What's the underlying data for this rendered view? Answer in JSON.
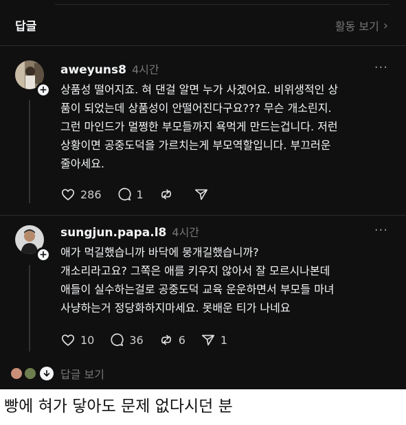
{
  "header": {
    "title": "답글",
    "activity_label": "활동 보기",
    "activity_chevron": "›"
  },
  "comments": [
    {
      "username": "aweyuns8",
      "time": "4시간",
      "more": "···",
      "lines": [
        "상품성 떨어지죠. 혀 댄걸 알면 누가 사겠어요. 비위생적인 상",
        "품이 되었는데 상품성이 안떨어진다구요??? 무슨 개소린지.",
        "그런 마인드가 멀쩡한 부모들까지 욕먹게 만드는겁니다. 저런",
        "상황이면 공중도덕을 가르치는게 부모역할입니다. 부끄러운",
        "줄아세요."
      ],
      "likes": "286",
      "replies": "1",
      "reposts": "",
      "shares": ""
    },
    {
      "username": "sungjun.papa.l8",
      "time": "4시간",
      "more": "···",
      "lines": [
        "애가 먹길했습니까 바닥에 뭉개길했습니까?",
        "개소리라고요? 그쪽은 애를 키우지 않아서 잘 모르시나본데",
        "애들이 실수하는걸로 공중도덕 교육 운운하면서 부모들 마녀",
        "사냥하는거 정당화하지마세요. 못배운 티가 나네요"
      ],
      "likes": "10",
      "replies": "36",
      "reposts": "6",
      "shares": "1"
    }
  ],
  "more_replies_label": "답글 보기",
  "caption": "빵에 혀가 닿아도 문제 없다시던 분",
  "colors": {
    "background": "#101010",
    "text_primary": "#f3f5f7",
    "text_secondary": "#777777",
    "divider": "#2c2c2c"
  },
  "icons": {
    "like": "heart-outline-icon",
    "reply": "speech-bubble-icon",
    "repost": "repost-arrows-icon",
    "share": "paper-plane-icon",
    "follow": "plus-icon",
    "expand": "chevron-down-icon"
  }
}
